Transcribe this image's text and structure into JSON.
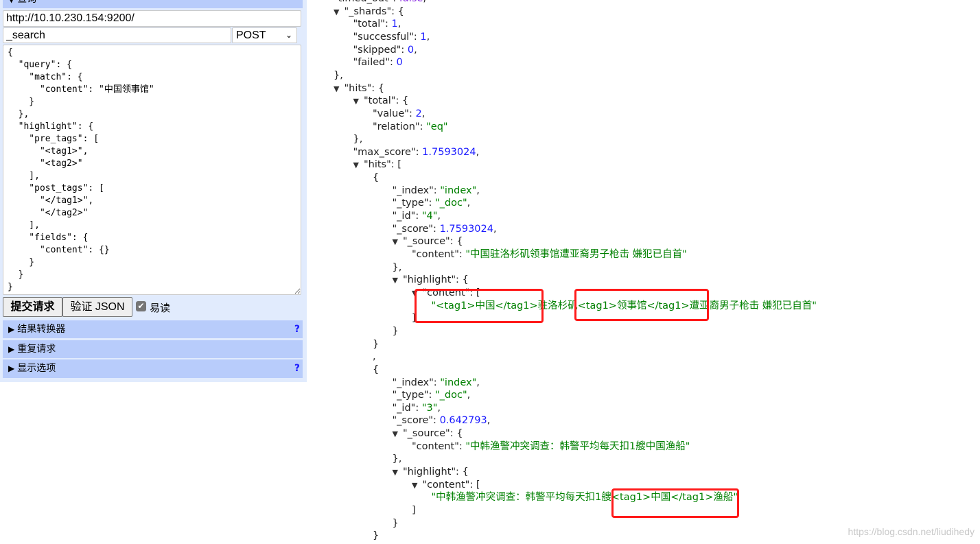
{
  "left": {
    "query_section": "查询",
    "url": "http://10.10.230.154:9200/",
    "path": "_search",
    "method": "POST",
    "body": "{\n  \"query\": {\n    \"match\": {\n      \"content\": \"中国领事馆\"\n    }\n  },\n  \"highlight\": {\n    \"pre_tags\": [\n      \"<tag1>\",\n      \"<tag2>\"\n    ],\n    \"post_tags\": [\n      \"</tag1>\",\n      \"</tag2>\"\n    ],\n    \"fields\": {\n      \"content\": {}\n    }\n  }\n}",
    "submit_label": "提交请求",
    "validate_label": "验证 JSON",
    "pretty_label": "易读",
    "pretty_checked": true,
    "sections": [
      {
        "label": "结果转换器",
        "help": "?"
      },
      {
        "label": "重复请求",
        "help": ""
      },
      {
        "label": "显示选项",
        "help": "?"
      }
    ]
  },
  "result_lines": [
    {
      "lv": 0,
      "k": "timed_out",
      "v": "false",
      "vt": "b",
      "p": ","
    },
    {
      "lv": 0,
      "t": true,
      "k": "_shards",
      "v": "{"
    },
    {
      "lv": 1,
      "k": "total",
      "v": "1",
      "vt": "n",
      "p": ","
    },
    {
      "lv": 1,
      "k": "successful",
      "v": "1",
      "vt": "n",
      "p": ","
    },
    {
      "lv": 1,
      "k": "skipped",
      "v": "0",
      "vt": "n",
      "p": ","
    },
    {
      "lv": 1,
      "k": "failed",
      "v": "0",
      "vt": "n"
    },
    {
      "lv": 0,
      "raw": "},"
    },
    {
      "lv": 0,
      "t": true,
      "k": "hits",
      "v": "{"
    },
    {
      "lv": 1,
      "t": true,
      "k": "total",
      "v": "{"
    },
    {
      "lv": 2,
      "k": "value",
      "v": "2",
      "vt": "n",
      "p": ","
    },
    {
      "lv": 2,
      "k": "relation",
      "v": "\"eq\"",
      "vt": "s"
    },
    {
      "lv": 1,
      "raw": "},"
    },
    {
      "lv": 1,
      "k": "max_score",
      "v": "1.7593024",
      "vt": "n",
      "p": ","
    },
    {
      "lv": 1,
      "t": true,
      "k": "hits",
      "v": "["
    },
    {
      "lv": 2,
      "raw": "{"
    },
    {
      "lv": 3,
      "k": "_index",
      "v": "\"index\"",
      "vt": "s",
      "p": ","
    },
    {
      "lv": 3,
      "k": "_type",
      "v": "\"_doc\"",
      "vt": "s",
      "p": ","
    },
    {
      "lv": 3,
      "k": "_id",
      "v": "\"4\"",
      "vt": "s",
      "p": ","
    },
    {
      "lv": 3,
      "k": "_score",
      "v": "1.7593024",
      "vt": "n",
      "p": ","
    },
    {
      "lv": 3,
      "t": true,
      "k": "_source",
      "v": "{"
    },
    {
      "lv": 4,
      "k": "content",
      "v": "\"中国驻洛杉矶领事馆遭亚裔男子枪击 嫌犯已自首\"",
      "vt": "s"
    },
    {
      "lv": 3,
      "raw": "},"
    },
    {
      "lv": 3,
      "t": true,
      "k": "highlight",
      "v": "{"
    },
    {
      "lv": 4,
      "t": true,
      "k": "content",
      "v": "["
    },
    {
      "lv": 5,
      "v": "\"<tag1>中国</tag1>驻洛杉矶<tag1>领事馆</tag1>遭亚裔男子枪击 嫌犯已自首\"",
      "vt": "s"
    },
    {
      "lv": 4,
      "raw": "]"
    },
    {
      "lv": 3,
      "raw": "}"
    },
    {
      "lv": 2,
      "raw": "}"
    },
    {
      "lv": 2,
      "raw": ","
    },
    {
      "lv": 2,
      "raw": "{"
    },
    {
      "lv": 3,
      "k": "_index",
      "v": "\"index\"",
      "vt": "s",
      "p": ","
    },
    {
      "lv": 3,
      "k": "_type",
      "v": "\"_doc\"",
      "vt": "s",
      "p": ","
    },
    {
      "lv": 3,
      "k": "_id",
      "v": "\"3\"",
      "vt": "s",
      "p": ","
    },
    {
      "lv": 3,
      "k": "_score",
      "v": "0.642793",
      "vt": "n",
      "p": ","
    },
    {
      "lv": 3,
      "t": true,
      "k": "_source",
      "v": "{"
    },
    {
      "lv": 4,
      "k": "content",
      "v": "\"中韩渔警冲突调查：韩警平均每天扣1艘中国渔船\"",
      "vt": "s"
    },
    {
      "lv": 3,
      "raw": "},"
    },
    {
      "lv": 3,
      "t": true,
      "k": "highlight",
      "v": "{"
    },
    {
      "lv": 4,
      "t": true,
      "k": "content",
      "v": "["
    },
    {
      "lv": 5,
      "v": "\"中韩渔警冲突调查：韩警平均每天扣1艘<tag1>中国</tag1>渔船\"",
      "vt": "s"
    },
    {
      "lv": 4,
      "raw": "]"
    },
    {
      "lv": 3,
      "raw": "}"
    },
    {
      "lv": 2,
      "raw": "}"
    }
  ],
  "annotation_color": "#ff1a1a",
  "watermark": "https://blog.csdn.net/liudihedy"
}
